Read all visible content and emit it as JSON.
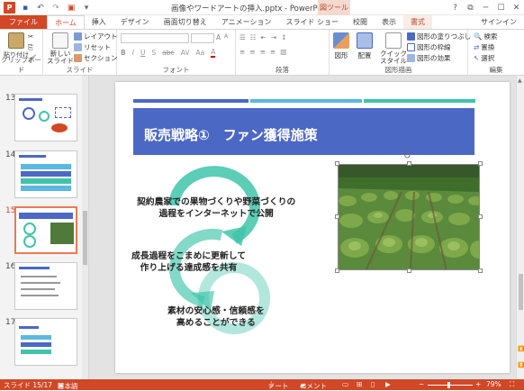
{
  "app": {
    "doc_title": "画像やワードアートの挿入.pptx - PowerPoint",
    "context_group": "図ツール",
    "signin": "サインイン",
    "window_buttons": [
      "?",
      "⧉",
      "─",
      "☐",
      "✕"
    ]
  },
  "qat": [
    "P",
    "💾",
    "↶",
    "↷",
    "▣",
    "▾"
  ],
  "tabs": [
    {
      "label": "ファイル",
      "kind": "file"
    },
    {
      "label": "ホーム",
      "kind": "active"
    },
    {
      "label": "挿入",
      "kind": ""
    },
    {
      "label": "デザイン",
      "kind": ""
    },
    {
      "label": "画面切り替え",
      "kind": ""
    },
    {
      "label": "アニメーション",
      "kind": ""
    },
    {
      "label": "スライド ショー",
      "kind": ""
    },
    {
      "label": "校閲",
      "kind": ""
    },
    {
      "label": "表示",
      "kind": ""
    },
    {
      "label": "書式",
      "kind": "ctx"
    }
  ],
  "ribbon": {
    "clipboard": {
      "label": "クリップボード",
      "paste": "貼り付け"
    },
    "slides": {
      "label": "スライド",
      "new_slide": "新しい\nスライド",
      "layout": "レイアウト",
      "reset": "リセット",
      "section": "セクション"
    },
    "font": {
      "label": "フォント",
      "bold": "B",
      "italic": "I",
      "underline": "U",
      "shadow": "S",
      "strike": "abc",
      "spacing": "AV",
      "case": "Aa",
      "color": "A"
    },
    "paragraph": {
      "label": "段落"
    },
    "drawing": {
      "label": "図形描画",
      "shapes": "図形",
      "arrange": "配置",
      "quick_styles": "クイック\nスタイル",
      "fill": "図形の塗りつぶし",
      "outline": "図形の枠線",
      "effects": "図形の効果"
    },
    "editing": {
      "label": "編集",
      "find": "検索",
      "replace": "置換",
      "select": "選択"
    }
  },
  "thumbnails": [
    {
      "num": "13",
      "selected": false
    },
    {
      "num": "14",
      "selected": false
    },
    {
      "num": "15",
      "selected": true
    },
    {
      "num": "16",
      "selected": false
    },
    {
      "num": "17",
      "selected": false
    }
  ],
  "slide": {
    "title": "販売戦略①　ファン獲得施策",
    "text1_line1": "契約農家での果物づくりや野菜づくりの",
    "text1_line2": "過程をインターネットで公開",
    "text2_line1": "成長過程をこまめに更新して",
    "text2_line2": "作り上げる達成感を共有",
    "text3_line1": "素材の安心感・信頼感を",
    "text3_line2": "高めることができる",
    "colors": {
      "title_bg": "#4c68c5",
      "arrow_teal": "#3fc4aa",
      "stripe1": "#4c68c5",
      "stripe2": "#5bb8e0",
      "stripe3": "#3fc4aa"
    }
  },
  "status": {
    "slide_info": "スライド 15/17",
    "language": "日本語",
    "notes": "ノート",
    "comments": "コメント",
    "zoom": "79%"
  }
}
